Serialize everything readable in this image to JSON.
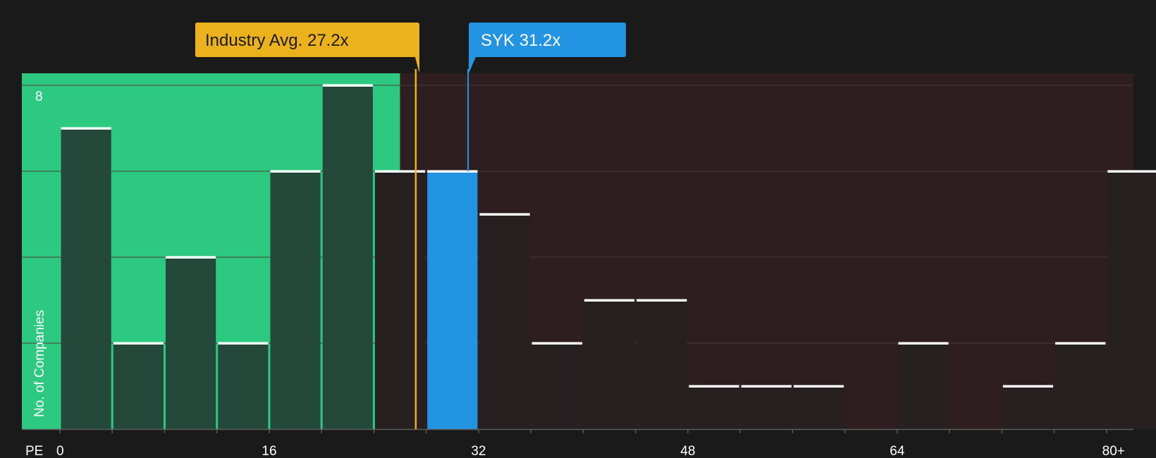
{
  "chart_data": {
    "type": "bar",
    "xlabel": "PE",
    "ylabel": "No. of Companies",
    "x_ticks": [
      "0",
      "16",
      "32",
      "48",
      "64",
      "80+"
    ],
    "y_ticks": [
      "8"
    ],
    "ylim": [
      0,
      8
    ],
    "bin_width": 4,
    "bins": [
      0,
      4,
      8,
      12,
      16,
      20,
      24,
      28,
      32,
      36,
      40,
      44,
      48,
      52,
      56,
      60,
      64,
      68,
      72,
      76,
      80
    ],
    "values": [
      7,
      2,
      4,
      2,
      6,
      8,
      6,
      6,
      5,
      2,
      3,
      3,
      1,
      1,
      1,
      0,
      2,
      0,
      1,
      2,
      6
    ],
    "highlight_bin": 28,
    "grid": true,
    "industry_avg": {
      "label": "Industry Avg. 27.2x",
      "value": 27.2
    },
    "company": {
      "label": "SYK 31.2x",
      "value": 31.2
    },
    "below_avg_region_end": 26
  },
  "colors": {
    "background": "#1a1a1a",
    "good_region": "#2ec981",
    "bad_region": "#2e1e1f",
    "bar_in_good": "#24493a",
    "bar_in_bad": "#262020",
    "bar_highlight": "#2394e1",
    "bar_top": "#ffffff",
    "industry": "#ecb21e",
    "company": "#2394e1",
    "grid": "#4a3a3a",
    "axis": "#5a5a5a"
  }
}
